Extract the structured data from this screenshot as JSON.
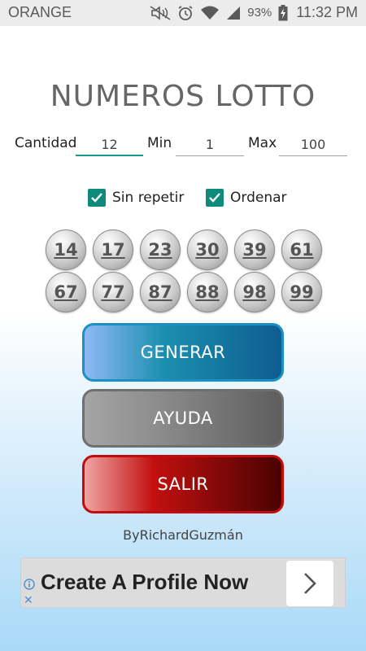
{
  "status_bar": {
    "carrier": "ORANGE",
    "battery": "93%",
    "time": "11:32 PM",
    "icons": [
      "mute-icon",
      "alarm-icon",
      "wifi-icon",
      "signal-icon",
      "battery-charging-icon"
    ]
  },
  "title": "NUMEROS LOTTO",
  "form": {
    "cantidad_label": "Cantidad",
    "cantidad_value": "12",
    "min_label": "Min",
    "min_value": "1",
    "max_label": "Max",
    "max_value": "100"
  },
  "options": {
    "sin_repetir_label": "Sin repetir",
    "sin_repetir_checked": true,
    "ordenar_label": "Ordenar",
    "ordenar_checked": true
  },
  "numbers": [
    "14",
    "17",
    "23",
    "30",
    "39",
    "61",
    "67",
    "77",
    "87",
    "88",
    "98",
    "99"
  ],
  "buttons": {
    "generar": "GENERAR",
    "ayuda": "AYUDA",
    "salir": "SALIR"
  },
  "credit": "ByRichardGuzmán",
  "ad": {
    "text": "Create A Profile Now"
  },
  "colors": {
    "accent": "#0e8a7d",
    "generar": "#1b8fb0",
    "ayuda": "#8a8a8a",
    "salir": "#c21010"
  }
}
